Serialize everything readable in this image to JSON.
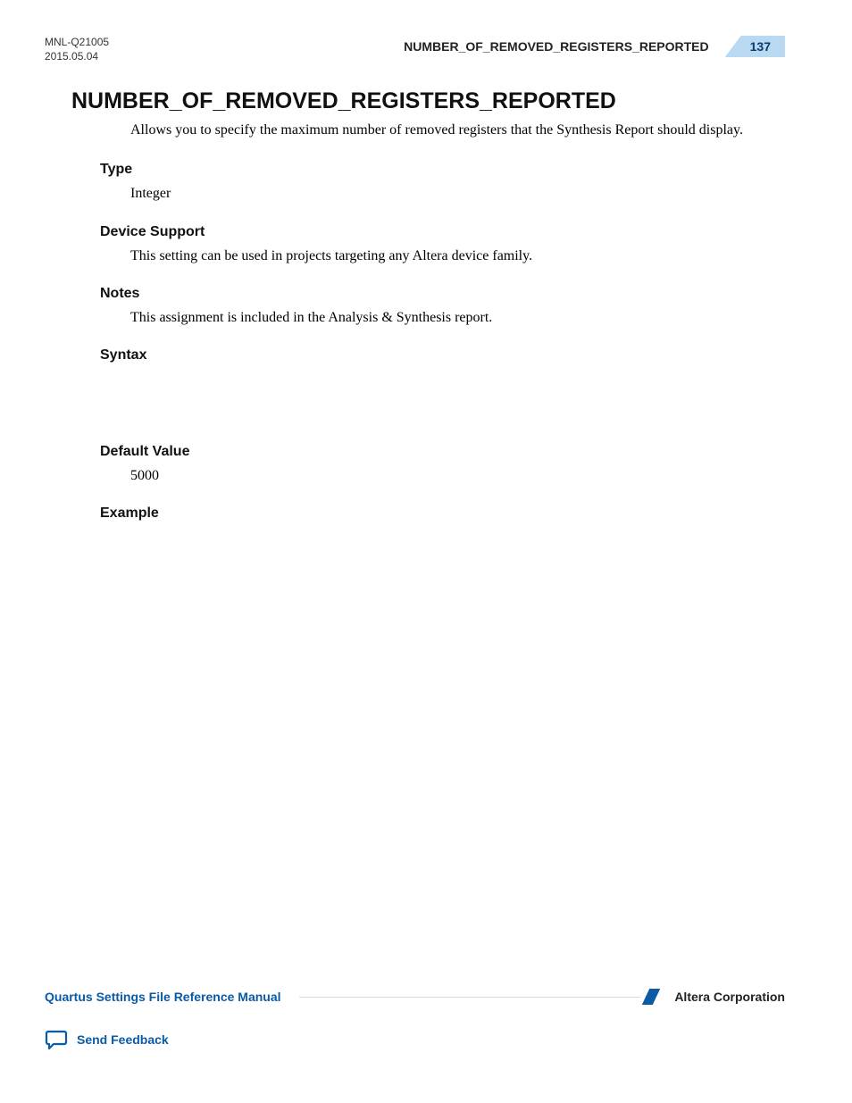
{
  "header": {
    "doc_id": "MNL-Q21005",
    "doc_date": "2015.05.04",
    "running_title": "NUMBER_OF_REMOVED_REGISTERS_REPORTED",
    "page_number": "137"
  },
  "main": {
    "title": "NUMBER_OF_REMOVED_REGISTERS_REPORTED",
    "intro": "Allows you to specify the maximum number of removed registers that the Synthesis Report should display.",
    "sections": {
      "type": {
        "head": "Type",
        "body": "Integer"
      },
      "device_support": {
        "head": "Device Support",
        "body": "This setting can be used in projects targeting any Altera device family."
      },
      "notes": {
        "head": "Notes",
        "body": "This assignment is included in the Analysis & Synthesis report."
      },
      "syntax": {
        "head": "Syntax"
      },
      "default_value": {
        "head": "Default Value",
        "body": "5000"
      },
      "example": {
        "head": "Example"
      }
    }
  },
  "footer": {
    "manual_title": "Quartus Settings File Reference Manual",
    "company": "Altera Corporation",
    "feedback": "Send Feedback"
  }
}
